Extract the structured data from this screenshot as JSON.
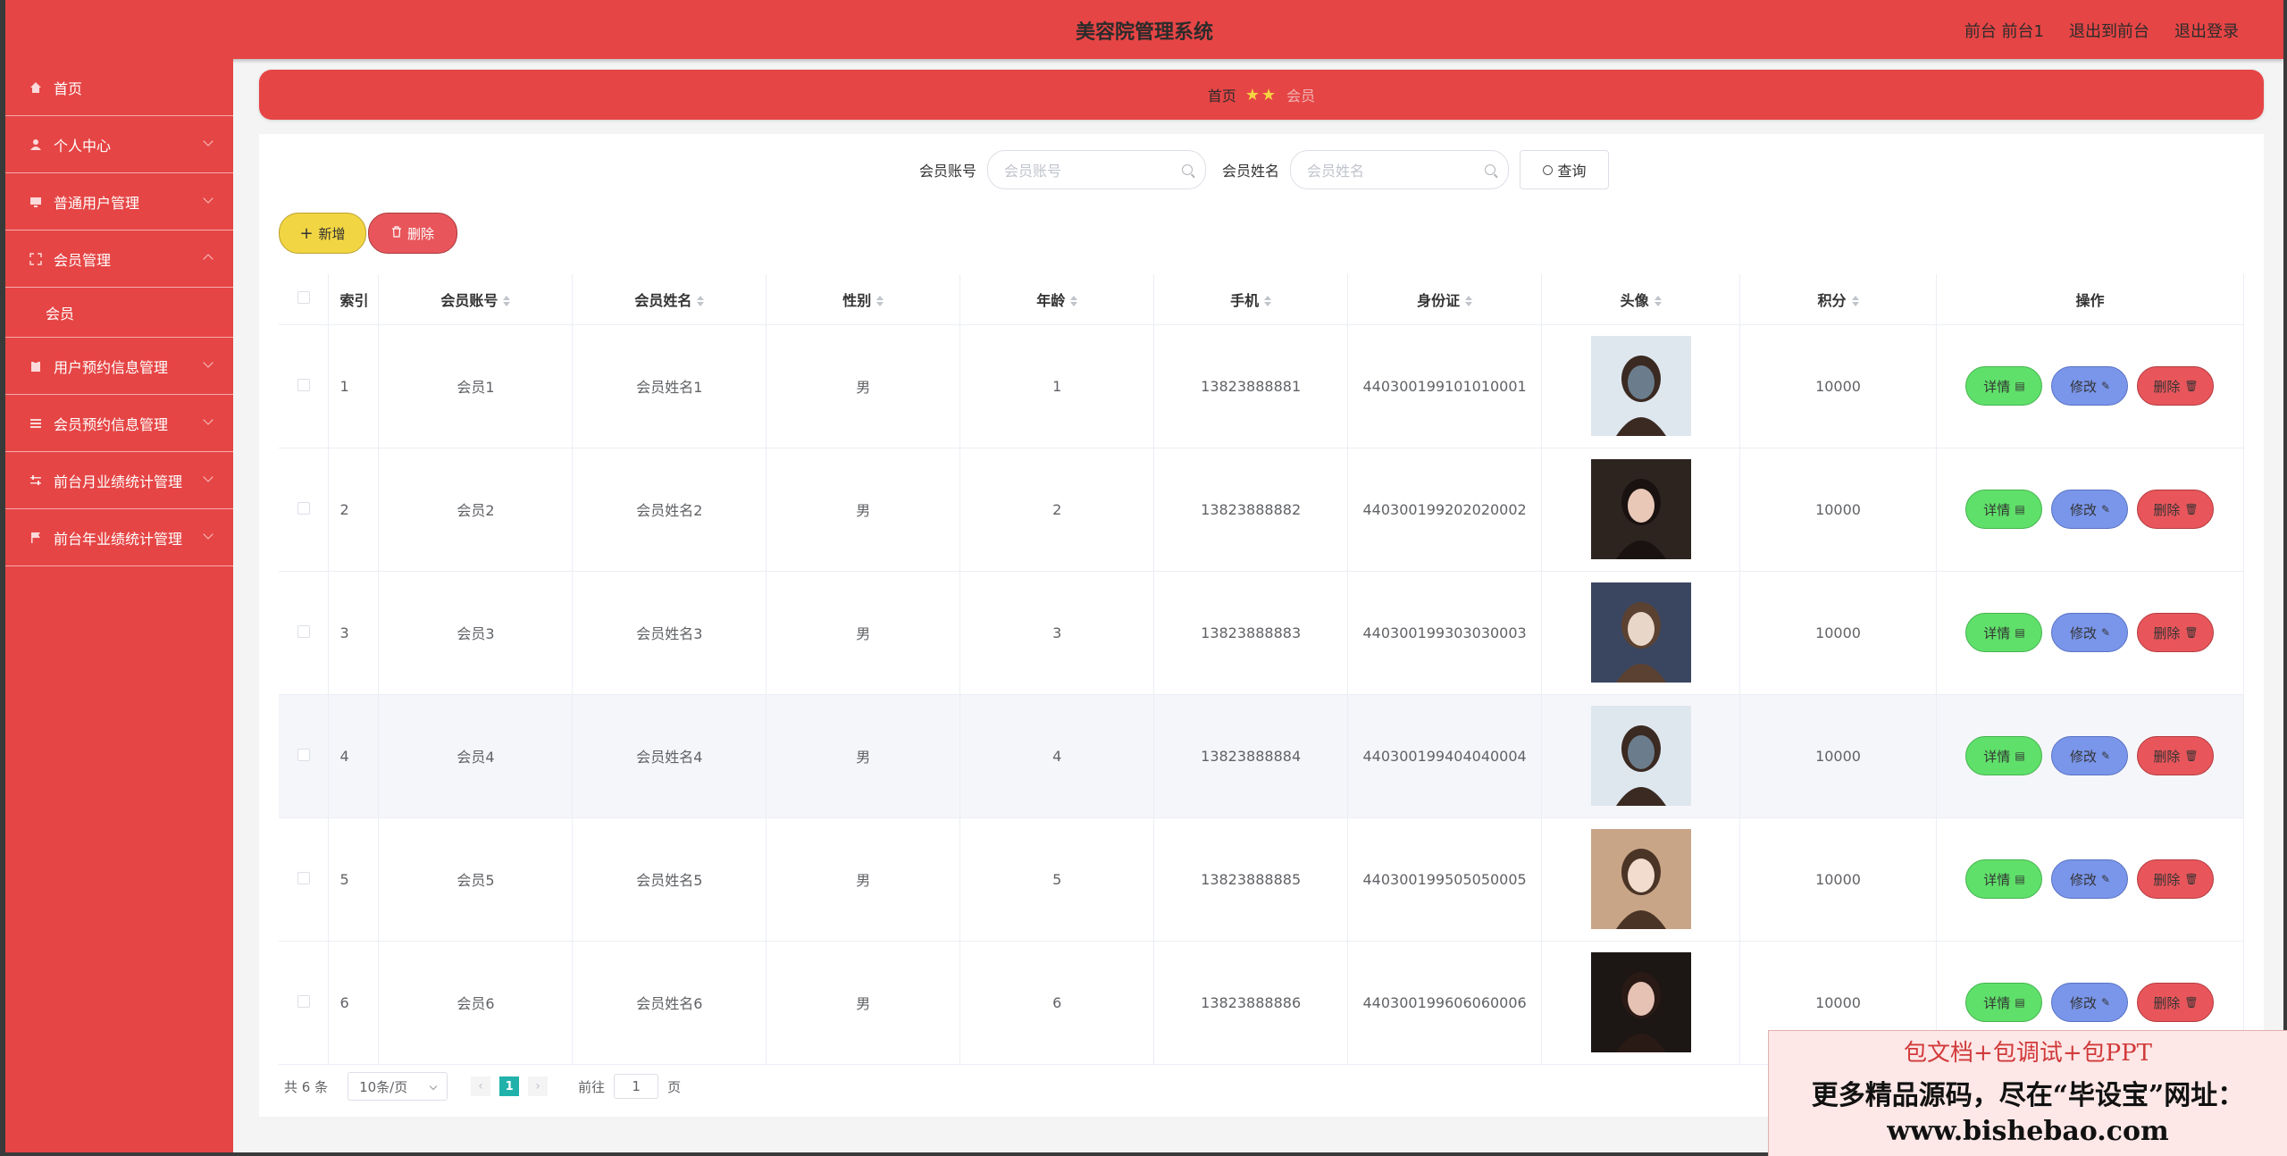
{
  "header": {
    "title": "美容院管理系统",
    "links": [
      "前台 前台1",
      "退出到前台",
      "退出登录"
    ]
  },
  "sidebar": {
    "items": [
      {
        "label": "首页",
        "icon": "home-icon",
        "expandable": false
      },
      {
        "label": "个人中心",
        "icon": "user-icon",
        "expandable": true
      },
      {
        "label": "普通用户管理",
        "icon": "monitor-icon",
        "expandable": true
      },
      {
        "label": "会员管理",
        "icon": "fullscreen-icon",
        "expandable": true,
        "expanded": true,
        "children": [
          "会员"
        ]
      },
      {
        "label": "用户预约信息管理",
        "icon": "clipboard-icon",
        "expandable": true
      },
      {
        "label": "会员预约信息管理",
        "icon": "list-icon",
        "expandable": true
      },
      {
        "label": "前台月业绩统计管理",
        "icon": "sliders-icon",
        "expandable": true
      },
      {
        "label": "前台年业绩统计管理",
        "icon": "flag-icon",
        "expandable": true
      }
    ]
  },
  "breadcrumb": {
    "home": "首页",
    "current": "会员"
  },
  "search": {
    "account_label": "会员账号",
    "account_placeholder": "会员账号",
    "name_label": "会员姓名",
    "name_placeholder": "会员姓名",
    "query_button": "查询"
  },
  "actions": {
    "add": "新增",
    "delete": "删除"
  },
  "table": {
    "columns": [
      "索引",
      "会员账号",
      "会员姓名",
      "性别",
      "年龄",
      "手机",
      "身份证",
      "头像",
      "积分",
      "操作"
    ],
    "rows": [
      {
        "index": "1",
        "account": "会员1",
        "name": "会员姓名1",
        "gender": "男",
        "age": "1",
        "phone": "13823888881",
        "id_card": "440300199101010001",
        "points": "10000"
      },
      {
        "index": "2",
        "account": "会员2",
        "name": "会员姓名2",
        "gender": "男",
        "age": "2",
        "phone": "13823888882",
        "id_card": "440300199202020002",
        "points": "10000"
      },
      {
        "index": "3",
        "account": "会员3",
        "name": "会员姓名3",
        "gender": "男",
        "age": "3",
        "phone": "13823888883",
        "id_card": "440300199303030003",
        "points": "10000"
      },
      {
        "index": "4",
        "account": "会员4",
        "name": "会员姓名4",
        "gender": "男",
        "age": "4",
        "phone": "13823888884",
        "id_card": "440300199404040004",
        "points": "10000"
      },
      {
        "index": "5",
        "account": "会员5",
        "name": "会员姓名5",
        "gender": "男",
        "age": "5",
        "phone": "13823888885",
        "id_card": "440300199505050005",
        "points": "10000"
      },
      {
        "index": "6",
        "account": "会员6",
        "name": "会员姓名6",
        "gender": "男",
        "age": "6",
        "phone": "13823888886",
        "id_card": "440300199606060006",
        "points": "10000"
      }
    ],
    "row_actions": {
      "detail": "详情",
      "edit": "修改",
      "remove": "删除"
    }
  },
  "pagination": {
    "total": "共 6 条",
    "page_size": "10条/页",
    "current_page": "1",
    "goto_label": "前往",
    "goto_value": "1",
    "page_suffix": "页"
  },
  "promo": {
    "line1": "包文档+包调试+包PPT",
    "line2": "更多精品源码，尽在“毕设宝”网址：",
    "line3": "www.bishebao.com"
  },
  "colors": {
    "primary": "#e64545",
    "add_button": "#f2d543",
    "detail_button": "#5fe06a",
    "edit_button": "#7a96eb",
    "page_active": "#20b2aa"
  }
}
